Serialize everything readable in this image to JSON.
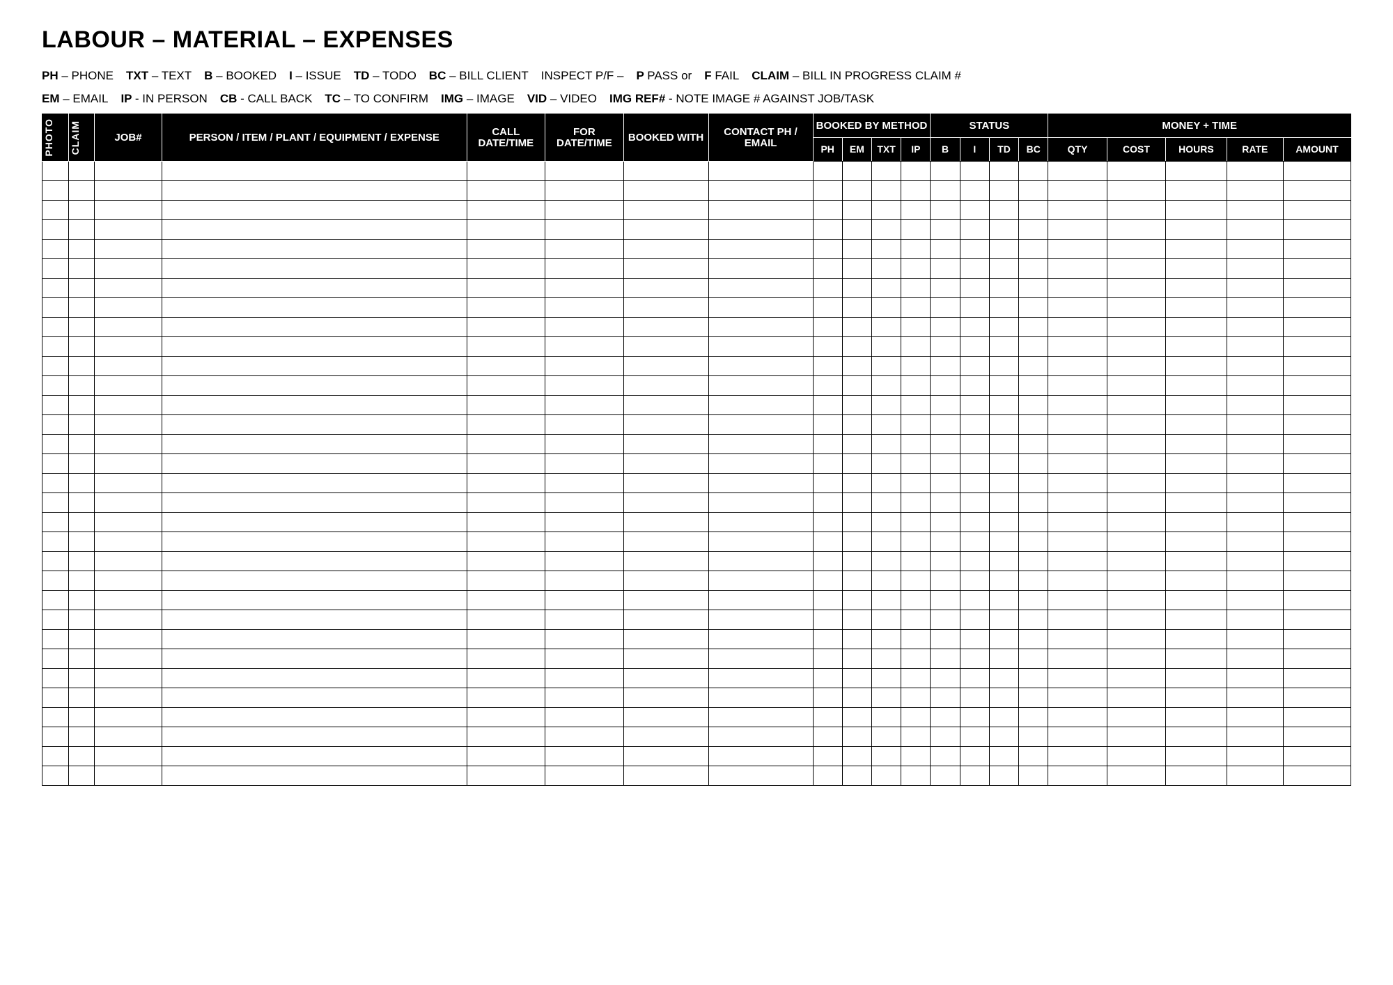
{
  "title": "LABOUR – MATERIAL – EXPENSES",
  "legend1": [
    {
      "code": "PH",
      "desc": "– PHONE"
    },
    {
      "code": "TXT",
      "desc": "– TEXT"
    },
    {
      "code": "B",
      "desc": "– BOOKED"
    },
    {
      "code": "I",
      "desc": "– ISSUE"
    },
    {
      "code": "TD",
      "desc": "– TODO"
    },
    {
      "code": "BC",
      "desc": "– BILL CLIENT"
    },
    {
      "code": "",
      "desc": "INSPECT P/F –"
    },
    {
      "code": "P",
      "desc": "PASS or"
    },
    {
      "code": "F",
      "desc": "FAIL"
    },
    {
      "code": "CLAIM",
      "desc": "– BILL IN PROGRESS CLAIM #"
    }
  ],
  "legend2": [
    {
      "code": "EM",
      "desc": "– EMAIL"
    },
    {
      "code": "IP",
      "desc": "- IN PERSON"
    },
    {
      "code": "CB",
      "desc": "- CALL BACK"
    },
    {
      "code": "TC",
      "desc": "– TO CONFIRM"
    },
    {
      "code": "IMG",
      "desc": "– IMAGE"
    },
    {
      "code": "VID",
      "desc": "– VIDEO"
    },
    {
      "code": "IMG REF#",
      "desc": "-  NOTE IMAGE # AGAINST JOB/TASK"
    }
  ],
  "headers": {
    "photo": "PHOTO",
    "claim": "CLAIM",
    "job": "JOB#",
    "desc": "PERSON / ITEM / PLANT / EQUIPMENT / EXPENSE",
    "call": "CALL DATE/TIME",
    "for": "FOR DATE/TIME",
    "bookedWith": "BOOKED WITH",
    "contact": "CONTACT PH / EMAIL",
    "bookedByMethod": "BOOKED BY METHOD",
    "status": "STATUS",
    "moneyTime": "MONEY + TIME",
    "ph": "PH",
    "em": "EM",
    "txt": "TXT",
    "ip": "IP",
    "b": "B",
    "i": "I",
    "td": "TD",
    "bc": "BC",
    "qty": "QTY",
    "cost": "COST",
    "hours": "HOURS",
    "rate": "RATE",
    "amount": "AMOUNT"
  },
  "rowCount": 32
}
